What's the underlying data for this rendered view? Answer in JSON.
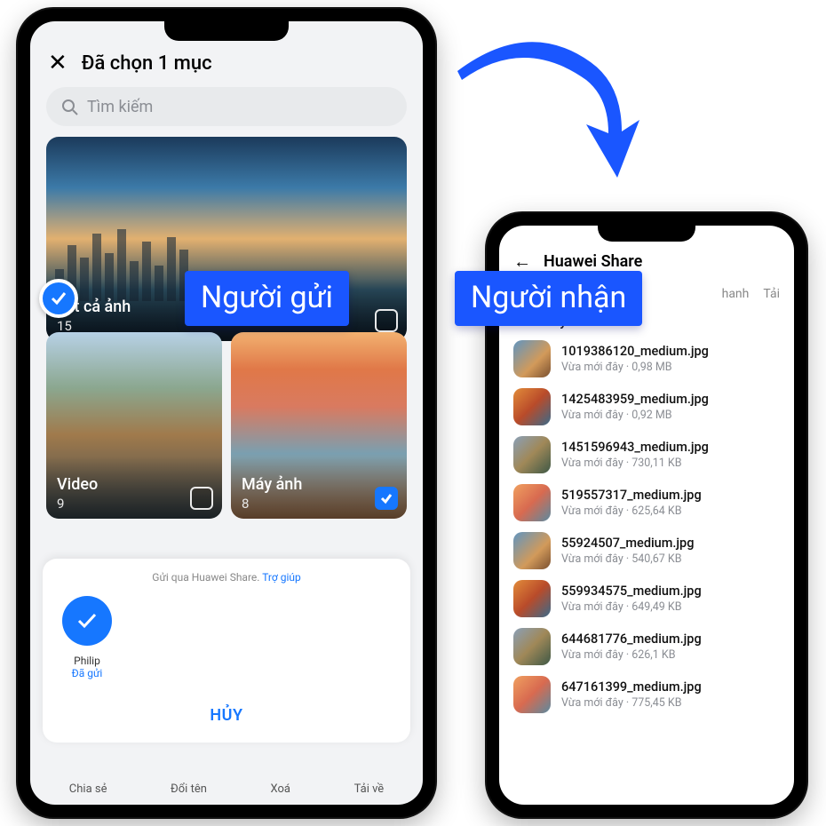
{
  "left": {
    "header": {
      "title": "Đã chọn 1 mục"
    },
    "search": {
      "placeholder": "Tìm kiếm"
    },
    "cards": {
      "all": {
        "title": "Tất cả ảnh",
        "count": "15"
      },
      "video": {
        "title": "Video",
        "count": "9"
      },
      "camera": {
        "title": "Máy ảnh",
        "count": "8"
      }
    },
    "share": {
      "hint": "Gửi qua Huawei Share.",
      "help": "Trợ giúp",
      "recipient_name": "Philip",
      "recipient_status": "Đã gửi",
      "cancel": "HỦY"
    },
    "bottom": {
      "share": "Chia sẻ",
      "rename": "Đổi tên",
      "delete": "Xoá",
      "download": "Tải về"
    }
  },
  "right": {
    "title": "Huawei Share",
    "tabs": {
      "t4_partial": "hanh",
      "t5_partial": "Tải"
    },
    "section": "Hôm nay",
    "files": [
      {
        "name": "1019386120_medium.jpg",
        "meta": "Vừa mới đây · 0,98 MB"
      },
      {
        "name": "1425483959_medium.jpg",
        "meta": "Vừa mới đây · 0,92 MB"
      },
      {
        "name": "1451596943_medium.jpg",
        "meta": "Vừa mới đây · 730,11 KB"
      },
      {
        "name": "519557317_medium.jpg",
        "meta": "Vừa mới đây · 625,64 KB"
      },
      {
        "name": "55924507_medium.jpg",
        "meta": "Vừa mới đây · 540,67 KB"
      },
      {
        "name": "559934575_medium.jpg",
        "meta": "Vừa mới đây · 649,49 KB"
      },
      {
        "name": "644681776_medium.jpg",
        "meta": "Vừa mới đây · 626,1 KB"
      },
      {
        "name": "647161399_medium.jpg",
        "meta": "Vừa mới đây · 775,45 KB"
      }
    ]
  },
  "callouts": {
    "sender": "Người gửi",
    "receiver": "Người nhận"
  }
}
